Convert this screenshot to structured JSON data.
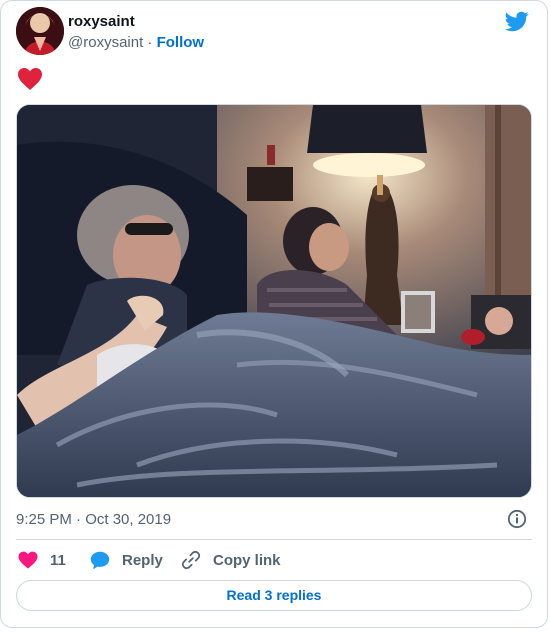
{
  "author": {
    "display_name": "roxysaint",
    "handle": "@roxysaint",
    "separator": " · ",
    "follow_label": "Follow"
  },
  "tweet": {
    "text_emoji": "heart",
    "timestamp": "9:25 PM · Oct 30, 2019"
  },
  "actions": {
    "like_count": "11",
    "reply_label": "Reply",
    "copy_link_label": "Copy link"
  },
  "footer": {
    "read_replies_label": "Read 3 replies"
  },
  "colors": {
    "brand": "#1d9bf0",
    "like": "#f91880",
    "link": "#006fd6",
    "muted": "#536471"
  },
  "icons": [
    "twitter-bird-icon",
    "heart-icon",
    "speech-bubble-icon",
    "link-icon",
    "info-icon"
  ]
}
